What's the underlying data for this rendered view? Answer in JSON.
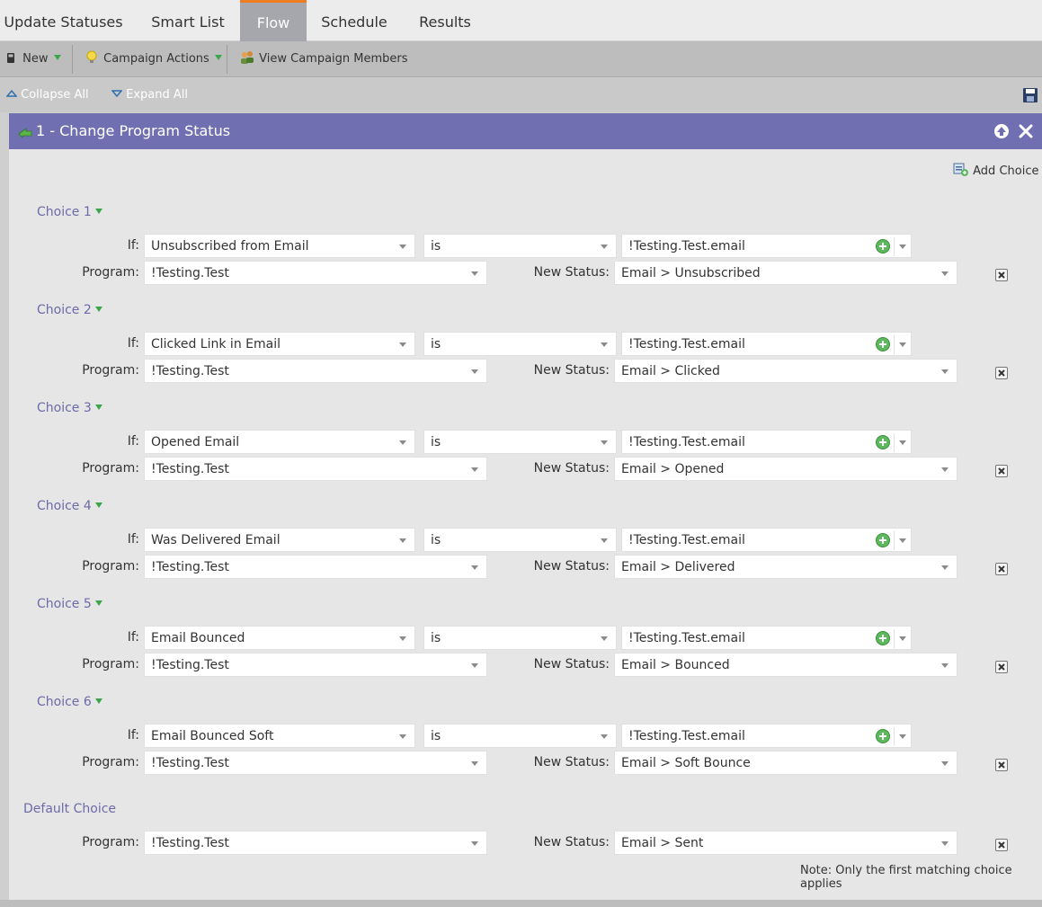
{
  "tabs": [
    {
      "label": "Update Statuses",
      "active": false
    },
    {
      "label": "Smart List",
      "active": false
    },
    {
      "label": "Flow",
      "active": true
    },
    {
      "label": "Schedule",
      "active": false
    },
    {
      "label": "Results",
      "active": false
    }
  ],
  "toolbar": {
    "new_label": "New",
    "campaign_actions_label": "Campaign Actions",
    "view_members_label": "View Campaign Members"
  },
  "subbar": {
    "collapse_label": "Collapse All",
    "expand_label": "Expand All"
  },
  "flow_step": {
    "title": "1 - Change Program Status",
    "add_choice_label": "Add Choice",
    "if_label": "If:",
    "program_label": "Program:",
    "new_status_label": "New Status:",
    "choices": [
      {
        "label": "Choice 1",
        "if_value": "Unsubscribed from Email",
        "operator": "is",
        "asset": "!Testing.Test.email",
        "program": "!Testing.Test",
        "new_status": "Email > Unsubscribed"
      },
      {
        "label": "Choice 2",
        "if_value": "Clicked Link in Email",
        "operator": "is",
        "asset": "!Testing.Test.email",
        "program": "!Testing.Test",
        "new_status": "Email > Clicked"
      },
      {
        "label": "Choice 3",
        "if_value": "Opened Email",
        "operator": "is",
        "asset": "!Testing.Test.email",
        "program": "!Testing.Test",
        "new_status": "Email > Opened"
      },
      {
        "label": "Choice 4",
        "if_value": "Was Delivered Email",
        "operator": "is",
        "asset": "!Testing.Test.email",
        "program": "!Testing.Test",
        "new_status": "Email > Delivered"
      },
      {
        "label": "Choice 5",
        "if_value": "Email Bounced",
        "operator": "is",
        "asset": "!Testing.Test.email",
        "program": "!Testing.Test",
        "new_status": "Email > Bounced"
      },
      {
        "label": "Choice 6",
        "if_value": "Email Bounced Soft",
        "operator": "is",
        "asset": "!Testing.Test.email",
        "program": "!Testing.Test",
        "new_status": "Email > Soft Bounce"
      }
    ],
    "default_choice": {
      "label": "Default Choice",
      "program": "!Testing.Test",
      "new_status": "Email > Sent"
    },
    "note": "Note: Only the first matching choice applies"
  },
  "colors": {
    "tab_accent": "#ef7d22",
    "panel_header": "#706fb2",
    "choice_label": "#6c6aa8",
    "add_icon_green": "#5eb95e"
  },
  "icons": [
    "new-icon",
    "lightbulb-icon",
    "people-icon",
    "collapse-icon",
    "expand-icon",
    "save-icon",
    "flow-step-icon",
    "move-up-icon",
    "close-icon",
    "add-choice-icon",
    "add-icon",
    "delete-icon"
  ]
}
